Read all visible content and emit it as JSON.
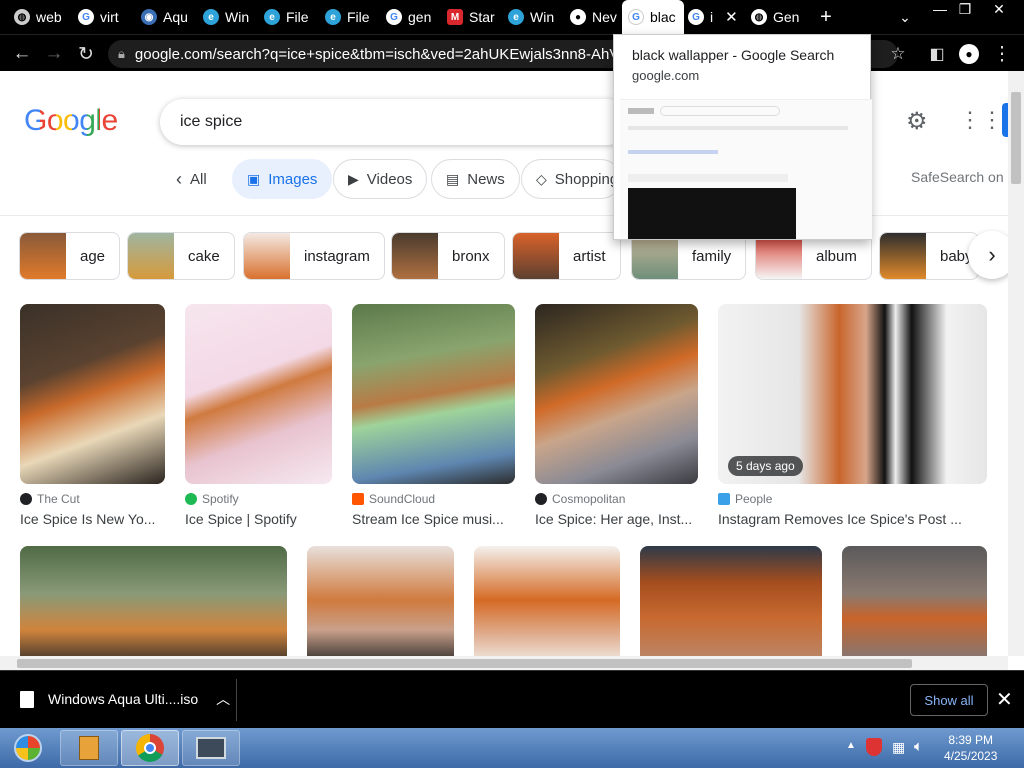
{
  "tabs": [
    {
      "label": "web",
      "icon": "globe-icon"
    },
    {
      "label": "virt",
      "icon": "google-icon"
    },
    {
      "label": "Aqu",
      "icon": "app-icon"
    },
    {
      "label": "Win",
      "icon": "edge-icon"
    },
    {
      "label": "File",
      "icon": "edge-icon"
    },
    {
      "label": "File",
      "icon": "edge-icon"
    },
    {
      "label": "gen",
      "icon": "google-icon"
    },
    {
      "label": "Star",
      "icon": "mega-icon"
    },
    {
      "label": "Win",
      "icon": "edge-icon"
    },
    {
      "label": "Nev",
      "icon": "github-icon"
    },
    {
      "label": "blac",
      "icon": "google-icon"
    },
    {
      "label": "i",
      "icon": "google-icon"
    },
    {
      "label": "Gen",
      "icon": "globe-icon"
    }
  ],
  "browser": {
    "url": "google.com/search?q=ice+spice&tbm=isch&ved=2ahUKEwjals3nn8-AhVP"
  },
  "hover_card": {
    "title": "black wallapper - Google Search",
    "domain": "google.com"
  },
  "google": {
    "logo": "Google",
    "query": "ice spice",
    "filters": [
      "All",
      "Images",
      "Videos",
      "News",
      "Shopping"
    ],
    "safesearch": "SafeSearch on"
  },
  "chips": [
    "age",
    "cake",
    "instagram",
    "bronx",
    "artist",
    "family",
    "album",
    "baby"
  ],
  "results_row1": [
    {
      "source": "The Cut",
      "title": "Ice Spice Is New Yo..."
    },
    {
      "source": "Spotify",
      "title": "Ice Spice | Spotify"
    },
    {
      "source": "SoundCloud",
      "title": "Stream Ice Spice musi..."
    },
    {
      "source": "Cosmopolitan",
      "title": "Ice Spice: Her age, Inst..."
    },
    {
      "source": "People",
      "title": "Instagram Removes Ice Spice's Post ...",
      "badge": "5 days ago"
    }
  ],
  "download": {
    "filename": "Windows Aqua Ulti....iso",
    "show_all": "Show all"
  },
  "clock": {
    "time": "8:39 PM",
    "date": "4/25/2023"
  },
  "colors": {
    "google_blue": "#4285F4",
    "google_red": "#EA4335",
    "google_yellow": "#FBBC05",
    "google_green": "#34A853",
    "chrome_dark": "#000000"
  }
}
